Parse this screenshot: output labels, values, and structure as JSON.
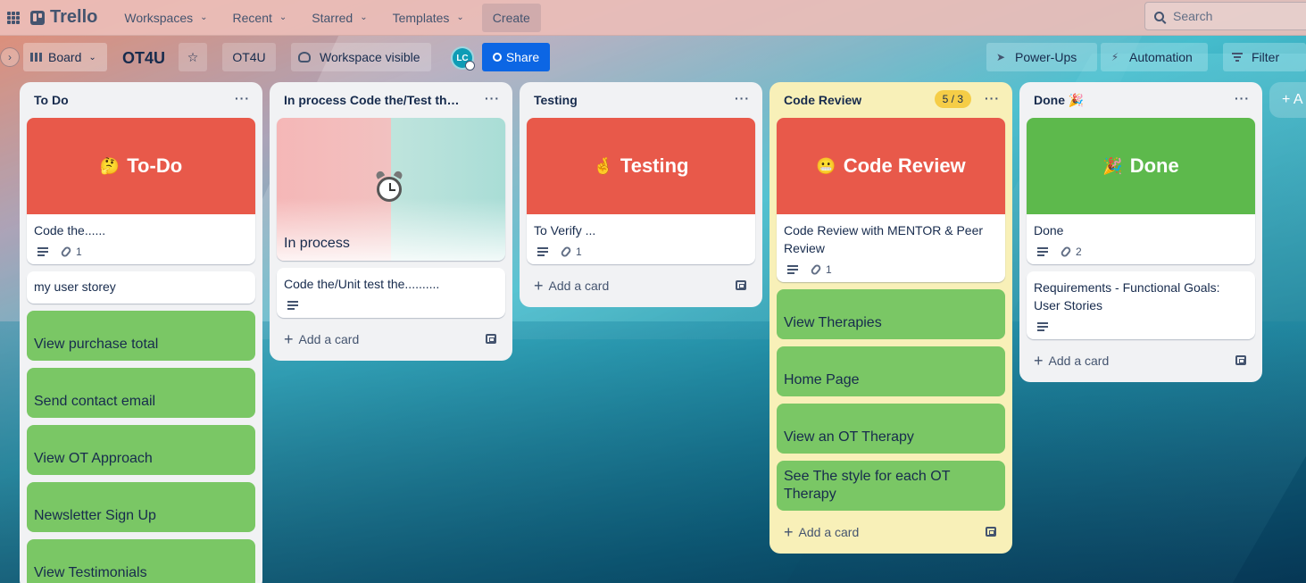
{
  "topbar": {
    "logo": "Trello",
    "nav": [
      "Workspaces",
      "Recent",
      "Starred",
      "Templates"
    ],
    "create": "Create",
    "search_placeholder": "Search"
  },
  "board": {
    "view": "Board",
    "title": "OT4U",
    "workspace": "OT4U",
    "visibility": "Workspace visible",
    "avatar": "LC",
    "share": "Share",
    "powerups": "Power-Ups",
    "automation": "Automation",
    "filter": "Filter",
    "add_list": "+ A"
  },
  "colors": {
    "cover_red": "#e8594a",
    "cover_green": "#5db94c",
    "label_green": "#7ac765",
    "review_bg": "#f8f0b8",
    "share_blue": "#0c66e4"
  },
  "add_card_label": "Add a card",
  "lists": [
    {
      "title": "To Do",
      "cover": {
        "emoji": "🤔",
        "text": "To-Do"
      },
      "card_title": "Code the......",
      "attachments": "1",
      "plain_card": "my user storey",
      "green_cards": [
        "View purchase total",
        "Send contact email",
        "View OT Approach",
        "Newsletter Sign Up",
        "View Testimonials"
      ]
    },
    {
      "title": "In process Code the/Test the....",
      "photo_card": "In process",
      "card_title": "Code the/Unit test the.........."
    },
    {
      "title": "Testing",
      "cover": {
        "emoji": "🤞",
        "text": "Testing"
      },
      "card_title": "To Verify ...",
      "attachments": "1"
    },
    {
      "title": "Code Review",
      "limit": "5 / 3",
      "cover": {
        "emoji": "😬",
        "text": "Code Review"
      },
      "card_title": "Code Review with MENTOR & Peer Review",
      "attachments": "1",
      "green_cards": [
        "View Therapies",
        "Home Page",
        "View an OT Therapy",
        "See The style for each OT Therapy"
      ]
    },
    {
      "title": "Done 🎉",
      "cover": {
        "emoji": "🎉",
        "text": "Done"
      },
      "card_title": "Done",
      "attachments": "2",
      "card2_title": "Requirements - Functional Goals: User Stories"
    }
  ]
}
